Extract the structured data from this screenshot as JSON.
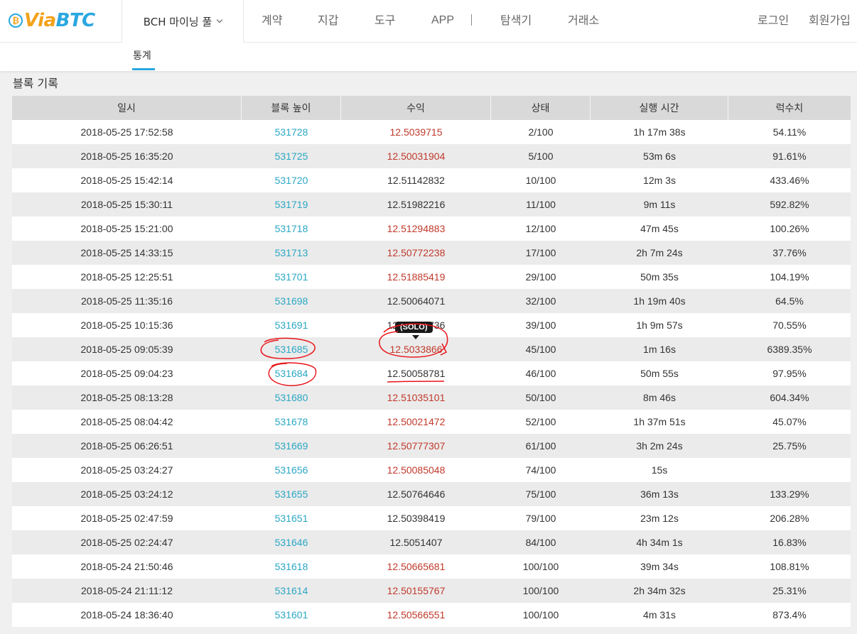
{
  "brand": {
    "coin_glyph": "₿",
    "name_prefix": "Via",
    "name_suffix": "BTC",
    "blue": "#2aa7e0",
    "orange": "#f3a21c"
  },
  "nav": {
    "pool": "BCH 마이닝 풀",
    "items": [
      "계약",
      "지갑",
      "도구",
      "APP",
      "탐색기",
      "거래소"
    ],
    "login": "로그인",
    "signup": "회원가입"
  },
  "subnav": {
    "tab": "통계"
  },
  "section_title": "블록 기록",
  "table": {
    "headers": [
      "일시",
      "블록 높이",
      "수익",
      "상태",
      "실행 시간",
      "럭수치"
    ],
    "rows": [
      {
        "time": "2018-05-25 17:52:58",
        "height": "531728",
        "reward": "12.5039715",
        "reward_color": "red",
        "status": "2/100",
        "duration": "1h 17m 38s",
        "luck": "54.11%"
      },
      {
        "time": "2018-05-25 16:35:20",
        "height": "531725",
        "reward": "12.50031904",
        "reward_color": "red",
        "status": "5/100",
        "duration": "53m 6s",
        "luck": "91.61%"
      },
      {
        "time": "2018-05-25 15:42:14",
        "height": "531720",
        "reward": "12.51142832",
        "reward_color": "dark",
        "status": "10/100",
        "duration": "12m 3s",
        "luck": "433.46%"
      },
      {
        "time": "2018-05-25 15:30:11",
        "height": "531719",
        "reward": "12.51982216",
        "reward_color": "dark",
        "status": "11/100",
        "duration": "9m 11s",
        "luck": "592.82%"
      },
      {
        "time": "2018-05-25 15:21:00",
        "height": "531718",
        "reward": "12.51294883",
        "reward_color": "red",
        "status": "12/100",
        "duration": "47m 45s",
        "luck": "100.26%"
      },
      {
        "time": "2018-05-25 14:33:15",
        "height": "531713",
        "reward": "12.50772238",
        "reward_color": "red",
        "status": "17/100",
        "duration": "2h 7m 24s",
        "luck": "37.76%"
      },
      {
        "time": "2018-05-25 12:25:51",
        "height": "531701",
        "reward": "12.51885419",
        "reward_color": "red",
        "status": "29/100",
        "duration": "50m 35s",
        "luck": "104.19%"
      },
      {
        "time": "2018-05-25 11:35:16",
        "height": "531698",
        "reward": "12.50064071",
        "reward_color": "dark",
        "status": "32/100",
        "duration": "1h 19m 40s",
        "luck": "64.5%"
      },
      {
        "time": "2018-05-25 10:15:36",
        "height": "531691",
        "reward": "12.51013736",
        "reward_color": "dark",
        "status": "39/100",
        "duration": "1h 9m 57s",
        "luck": "70.55%"
      },
      {
        "time": "2018-05-25 09:05:39",
        "height": "531685",
        "reward": "12.5033866",
        "reward_color": "red",
        "status": "45/100",
        "duration": "1m 16s",
        "luck": "6389.35%"
      },
      {
        "time": "2018-05-25 09:04:23",
        "height": "531684",
        "reward": "12.50058781",
        "reward_color": "dark",
        "status": "46/100",
        "duration": "50m 55s",
        "luck": "97.95%"
      },
      {
        "time": "2018-05-25 08:13:28",
        "height": "531680",
        "reward": "12.51035101",
        "reward_color": "red",
        "status": "50/100",
        "duration": "8m 46s",
        "luck": "604.34%"
      },
      {
        "time": "2018-05-25 08:04:42",
        "height": "531678",
        "reward": "12.50021472",
        "reward_color": "red",
        "status": "52/100",
        "duration": "1h 37m 51s",
        "luck": "45.07%"
      },
      {
        "time": "2018-05-25 06:26:51",
        "height": "531669",
        "reward": "12.50777307",
        "reward_color": "red",
        "status": "61/100",
        "duration": "3h 2m 24s",
        "luck": "25.75%"
      },
      {
        "time": "2018-05-25 03:24:27",
        "height": "531656",
        "reward": "12.50085048",
        "reward_color": "red",
        "status": "74/100",
        "duration": "15s",
        "luck": ""
      },
      {
        "time": "2018-05-25 03:24:12",
        "height": "531655",
        "reward": "12.50764646",
        "reward_color": "dark",
        "status": "75/100",
        "duration": "36m 13s",
        "luck": "133.29%"
      },
      {
        "time": "2018-05-25 02:47:59",
        "height": "531651",
        "reward": "12.50398419",
        "reward_color": "dark",
        "status": "79/100",
        "duration": "23m 12s",
        "luck": "206.28%"
      },
      {
        "time": "2018-05-25 02:24:47",
        "height": "531646",
        "reward": "12.5051407",
        "reward_color": "dark",
        "status": "84/100",
        "duration": "4h 34m 1s",
        "luck": "16.83%"
      },
      {
        "time": "2018-05-24 21:50:46",
        "height": "531618",
        "reward": "12.50665681",
        "reward_color": "red",
        "status": "100/100",
        "duration": "39m 34s",
        "luck": "108.81%"
      },
      {
        "time": "2018-05-24 21:11:12",
        "height": "531614",
        "reward": "12.50155767",
        "reward_color": "red",
        "status": "100/100",
        "duration": "2h 34m 32s",
        "luck": "25.31%"
      },
      {
        "time": "2018-05-24 18:36:40",
        "height": "531601",
        "reward": "12.50566551",
        "reward_color": "red",
        "status": "100/100",
        "duration": "4m 31s",
        "luck": "873.4%"
      }
    ]
  },
  "tooltip": {
    "text": "(SOLO)"
  },
  "colors": {
    "link": "#2aa7c4",
    "reward_red": "#c0392b",
    "annotation_red": "#e8141a",
    "accent": "#2aa7e0"
  }
}
